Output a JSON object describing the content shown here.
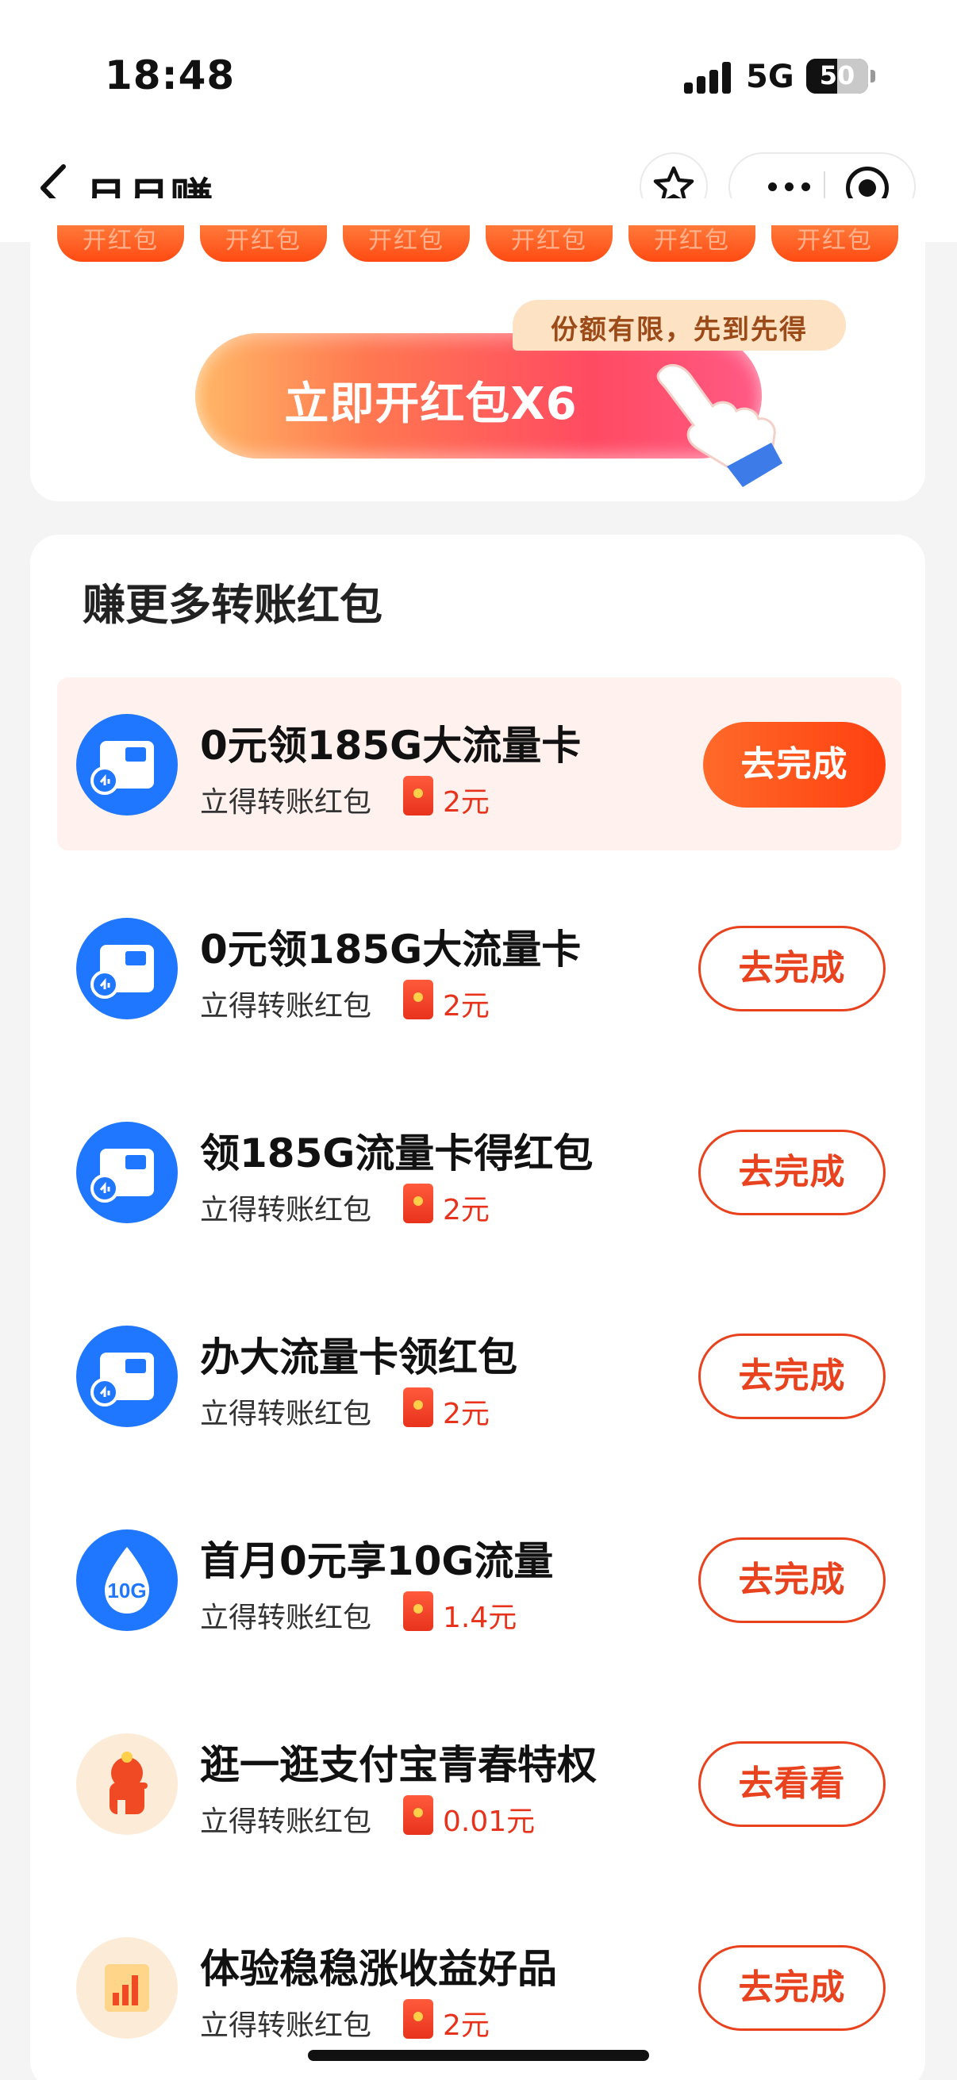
{
  "status_bar": {
    "time": "18:48",
    "network": "5G",
    "battery_level": "50"
  },
  "nav": {
    "title": "月月赚",
    "back_icon": "chevron-left-icon",
    "favorite_icon": "star-icon",
    "more_icon": "more-dots-icon",
    "close_icon": "target-circle-icon"
  },
  "red_packet_pills": [
    "开红包",
    "开红包",
    "开红包",
    "开红包",
    "开红包",
    "开红包"
  ],
  "open_button": {
    "label": "立即开红包X6",
    "tip": "份额有限，先到先得"
  },
  "tasks_section": {
    "title": "赚更多转账红包",
    "items": [
      {
        "title": "0元领185G大流量卡",
        "subtitle": "立得转账红包",
        "reward": "2元",
        "button": "去完成",
        "icon": "sim-card-icon"
      },
      {
        "title": "0元领185G大流量卡",
        "subtitle": "立得转账红包",
        "reward": "2元",
        "button": "去完成",
        "icon": "sim-card-icon"
      },
      {
        "title": "领185G流量卡得红包",
        "subtitle": "立得转账红包",
        "reward": "2元",
        "button": "去完成",
        "icon": "sim-card-icon"
      },
      {
        "title": "办大流量卡领红包",
        "subtitle": "立得转账红包",
        "reward": "2元",
        "button": "去完成",
        "icon": "sim-card-icon"
      },
      {
        "title": "首月0元享10G流量",
        "subtitle": "立得转账红包",
        "reward": "1.4元",
        "button": "去完成",
        "icon": "data-drop-icon",
        "icon_text": "10G"
      },
      {
        "title": "逛一逛支付宝青春特权",
        "subtitle": "立得转账红包",
        "reward": "0.01元",
        "button": "去看看",
        "icon": "mascot-icon"
      },
      {
        "title": "体验稳稳涨收益好品",
        "subtitle": "立得转账红包",
        "reward": "2元",
        "button": "去完成",
        "icon": "growth-chart-icon"
      }
    ]
  },
  "colors": {
    "accent": "#e8431e",
    "icon_blue": "#1f76ff",
    "highlight_bg": "#fff1ee"
  }
}
